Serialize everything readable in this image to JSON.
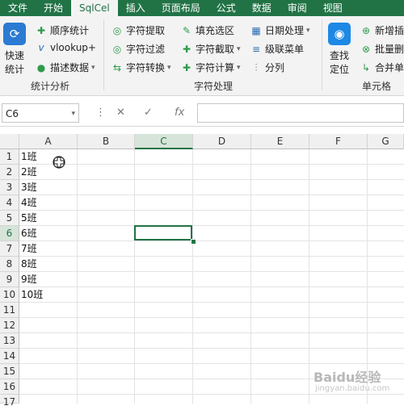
{
  "tabs": [
    "文件",
    "开始",
    "SqlCel",
    "插入",
    "页面布局",
    "公式",
    "数据",
    "审阅",
    "视图"
  ],
  "ribbon": {
    "quick_stats": {
      "line1": "快速",
      "line2": "统计"
    },
    "stats_group": {
      "items": [
        "顺序统计",
        "vlookup+",
        "描述数据"
      ],
      "label": "统计分析"
    },
    "string_group": {
      "col1": [
        "字符提取",
        "字符过滤",
        "字符转换"
      ],
      "col2": [
        "填充选区",
        "字符截取",
        "字符计算"
      ],
      "col3": [
        "日期处理",
        "级联菜单",
        "分列"
      ],
      "label": "字符处理"
    },
    "find_locate": {
      "line1": "查找",
      "line2": "定位"
    },
    "cell_group": {
      "items": [
        "新增插",
        "批量删",
        "合并单"
      ],
      "label": "单元格"
    }
  },
  "formula_bar": {
    "name_box": "C6",
    "cancel": "✕",
    "confirm": "✓",
    "fx": "fx",
    "content": ""
  },
  "sheet": {
    "columns": [
      "A",
      "B",
      "C",
      "D",
      "E",
      "F",
      "G"
    ],
    "rows": [
      "1",
      "2",
      "3",
      "4",
      "5",
      "6",
      "7",
      "8",
      "9",
      "10",
      "11",
      "12",
      "13",
      "14",
      "15",
      "16",
      "17"
    ],
    "column_a_values": [
      "1班",
      "2班",
      "3班",
      "4班",
      "5班",
      "6班",
      "7班",
      "8班",
      "9班",
      "10班"
    ],
    "selected_cell": "C6"
  },
  "watermark": {
    "text": "Baidu经验",
    "sub": "jingyan.baidu.com"
  },
  "colors": {
    "accent": "#217346",
    "ribbon_bg": "#f3f3f3"
  }
}
